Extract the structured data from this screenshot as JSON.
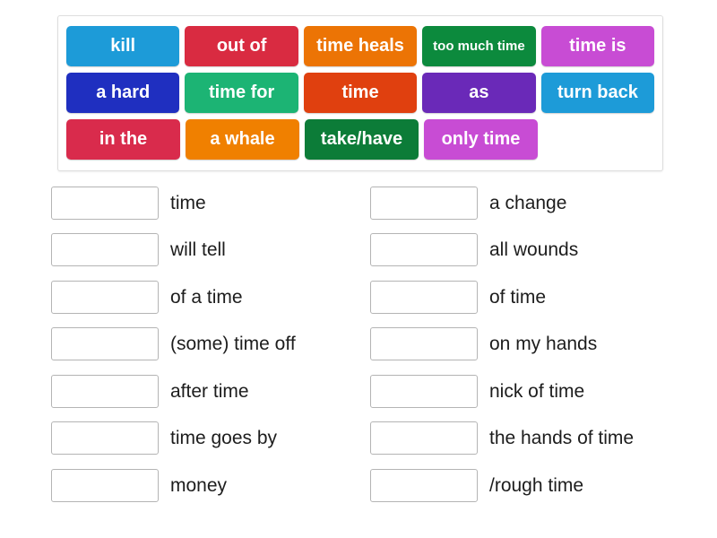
{
  "tile_bank": {
    "rows": [
      [
        {
          "label": "kill",
          "color": "#1d9bd8",
          "size": "normal"
        },
        {
          "label": "out of",
          "color": "#d92b41",
          "size": "normal"
        },
        {
          "label": "time heals",
          "color": "#ec7405",
          "size": "normal"
        },
        {
          "label": "too much time",
          "color": "#0c8a3d",
          "size": "small"
        },
        {
          "label": "time is",
          "color": "#c84cd4",
          "size": "normal"
        }
      ],
      [
        {
          "label": "a hard",
          "color": "#1f2fc0",
          "size": "normal"
        },
        {
          "label": "time for",
          "color": "#1cb474",
          "size": "normal"
        },
        {
          "label": "time",
          "color": "#e0400f",
          "size": "normal"
        },
        {
          "label": "as",
          "color": "#6a29b8",
          "size": "normal"
        },
        {
          "label": "turn back",
          "color": "#1d9bd8",
          "size": "normal"
        }
      ],
      [
        {
          "label": "in the",
          "color": "#d92b4c",
          "size": "normal"
        },
        {
          "label": "a whale",
          "color": "#f08000",
          "size": "normal"
        },
        {
          "label": "take/have",
          "color": "#0c7c38",
          "size": "normal"
        },
        {
          "label": "only time",
          "color": "#c84cd4",
          "size": "normal"
        }
      ]
    ]
  },
  "answers": {
    "left_column": [
      {
        "label": "time"
      },
      {
        "label": "will tell"
      },
      {
        "label": "of a time"
      },
      {
        "label": "(some) time off"
      },
      {
        "label": "after time"
      },
      {
        "label": "time goes by"
      },
      {
        "label": "money"
      }
    ],
    "right_column": [
      {
        "label": "a change"
      },
      {
        "label": "all wounds"
      },
      {
        "label": "of time"
      },
      {
        "label": "on my hands"
      },
      {
        "label": "nick of time"
      },
      {
        "label": "the hands of time"
      },
      {
        "label": "/rough time"
      }
    ]
  }
}
